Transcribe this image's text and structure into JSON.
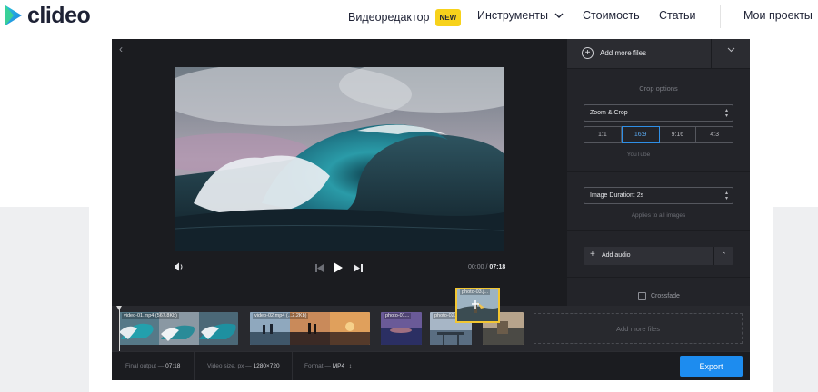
{
  "header": {
    "logo_text": "clideo",
    "nav": {
      "video_editor": "Видеоредактор",
      "new_badge": "NEW",
      "tools": "Инструменты",
      "pricing": "Стоимость",
      "articles": "Статьи",
      "my_projects": "Мои проекты"
    }
  },
  "player": {
    "current_time": "00:00",
    "separator": "/",
    "duration": "07:18"
  },
  "panel": {
    "add_more_files": "Add more files",
    "crop_title": "Crop options",
    "crop_select": "Zoom & Crop",
    "ratios": [
      "1:1",
      "16:9",
      "9:16",
      "4:3"
    ],
    "selected_ratio": "16:9",
    "ratio_hint": "YouTube",
    "image_duration": "Image Duration: 2s",
    "duration_hint": "Applies to all images",
    "add_audio": "Add audio",
    "crossfade": "Crossfade"
  },
  "timeline": {
    "clips": [
      {
        "label": "video-01.mp4 (567.8Kb)"
      },
      {
        "label": "video-02.mp4 (...2.2Kb)"
      },
      {
        "label": "photo-01..."
      },
      {
        "label": "photo-02..."
      },
      {
        "label": ""
      }
    ],
    "dragging_label": "photo-03.j...",
    "drop_zone": "Add more files"
  },
  "footer": {
    "final_output_label": "Final output —",
    "final_output_value": "07:18",
    "video_size_label": "Video size, px —",
    "video_size_value": "1280×720",
    "format_label": "Format —",
    "format_value": "MP4",
    "export": "Export"
  },
  "colors": {
    "accent": "#1d8cef",
    "badge": "#f7d21b",
    "drag_outline": "#f2c631",
    "editor_bg": "#1b1c20"
  }
}
